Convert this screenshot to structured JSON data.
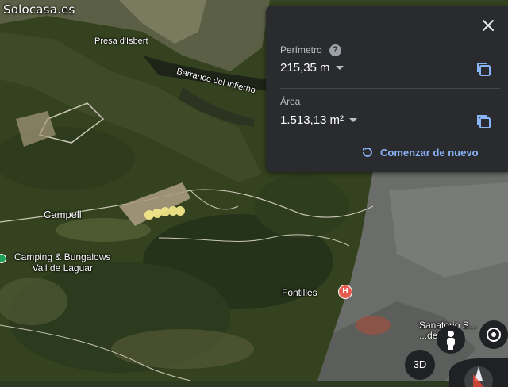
{
  "watermark": "Solocasa.es",
  "map": {
    "labels": {
      "presa": "Presa d'Isbert",
      "barranco": "Barranco del Infierno",
      "campell": "Campell",
      "camping_line1": "Camping & Bungalows",
      "camping_line2": "Vall de Laguar",
      "fontilles": "Fontilles",
      "sanatorio_line1": "Sanatorio S...",
      "sanatorio_line2": "...de Borja"
    },
    "hospital_marker": "H"
  },
  "panel": {
    "perimeter_label": "Perímetro",
    "perimeter_value": "215,35 m",
    "area_label": "Área",
    "area_value": "1.513,13 m²",
    "restart_label": "Comenzar de nuevo",
    "help_glyph": "?",
    "colors": {
      "background": "#2a2b2e",
      "link": "#8ab4f8"
    }
  },
  "controls": {
    "view_3d_label": "3D",
    "icons": [
      "close-icon",
      "help-icon",
      "copy-icon",
      "chevron-down-icon",
      "restart-icon",
      "pegman-icon",
      "locate-icon",
      "compass-icon"
    ]
  }
}
